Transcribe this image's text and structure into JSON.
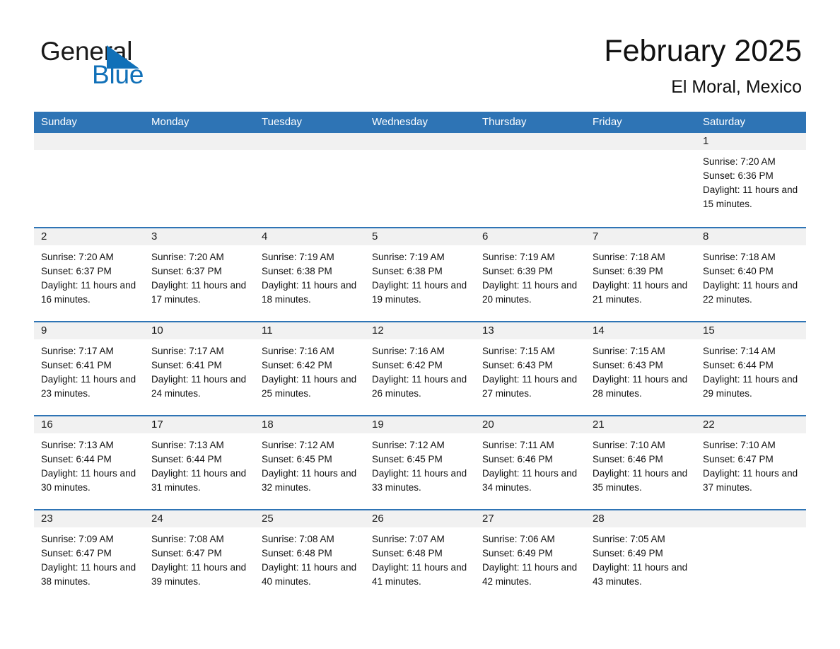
{
  "brand": {
    "name_part1": "General",
    "name_part2": "Blue",
    "triangle_icon": "triangle-icon",
    "accent_color": "#1070b8"
  },
  "header": {
    "title": "February 2025",
    "subtitle": "El Moral, Mexico"
  },
  "theme": {
    "header_blue": "#2e74b5",
    "date_band_gray": "#f1f1f1",
    "text_black": "#111111"
  },
  "calendar": {
    "weekdays": [
      "Sunday",
      "Monday",
      "Tuesday",
      "Wednesday",
      "Thursday",
      "Friday",
      "Saturday"
    ],
    "weeks": [
      {
        "days": [
          {
            "date": "",
            "lines": []
          },
          {
            "date": "",
            "lines": []
          },
          {
            "date": "",
            "lines": []
          },
          {
            "date": "",
            "lines": []
          },
          {
            "date": "",
            "lines": []
          },
          {
            "date": "",
            "lines": []
          },
          {
            "date": "1",
            "lines": [
              "Sunrise: 7:20 AM",
              "Sunset: 6:36 PM",
              "Daylight: 11 hours and 15 minutes."
            ]
          }
        ]
      },
      {
        "days": [
          {
            "date": "2",
            "lines": [
              "Sunrise: 7:20 AM",
              "Sunset: 6:37 PM",
              "Daylight: 11 hours and 16 minutes."
            ]
          },
          {
            "date": "3",
            "lines": [
              "Sunrise: 7:20 AM",
              "Sunset: 6:37 PM",
              "Daylight: 11 hours and 17 minutes."
            ]
          },
          {
            "date": "4",
            "lines": [
              "Sunrise: 7:19 AM",
              "Sunset: 6:38 PM",
              "Daylight: 11 hours and 18 minutes."
            ]
          },
          {
            "date": "5",
            "lines": [
              "Sunrise: 7:19 AM",
              "Sunset: 6:38 PM",
              "Daylight: 11 hours and 19 minutes."
            ]
          },
          {
            "date": "6",
            "lines": [
              "Sunrise: 7:19 AM",
              "Sunset: 6:39 PM",
              "Daylight: 11 hours and 20 minutes."
            ]
          },
          {
            "date": "7",
            "lines": [
              "Sunrise: 7:18 AM",
              "Sunset: 6:39 PM",
              "Daylight: 11 hours and 21 minutes."
            ]
          },
          {
            "date": "8",
            "lines": [
              "Sunrise: 7:18 AM",
              "Sunset: 6:40 PM",
              "Daylight: 11 hours and 22 minutes."
            ]
          }
        ]
      },
      {
        "days": [
          {
            "date": "9",
            "lines": [
              "Sunrise: 7:17 AM",
              "Sunset: 6:41 PM",
              "Daylight: 11 hours and 23 minutes."
            ]
          },
          {
            "date": "10",
            "lines": [
              "Sunrise: 7:17 AM",
              "Sunset: 6:41 PM",
              "Daylight: 11 hours and 24 minutes."
            ]
          },
          {
            "date": "11",
            "lines": [
              "Sunrise: 7:16 AM",
              "Sunset: 6:42 PM",
              "Daylight: 11 hours and 25 minutes."
            ]
          },
          {
            "date": "12",
            "lines": [
              "Sunrise: 7:16 AM",
              "Sunset: 6:42 PM",
              "Daylight: 11 hours and 26 minutes."
            ]
          },
          {
            "date": "13",
            "lines": [
              "Sunrise: 7:15 AM",
              "Sunset: 6:43 PM",
              "Daylight: 11 hours and 27 minutes."
            ]
          },
          {
            "date": "14",
            "lines": [
              "Sunrise: 7:15 AM",
              "Sunset: 6:43 PM",
              "Daylight: 11 hours and 28 minutes."
            ]
          },
          {
            "date": "15",
            "lines": [
              "Sunrise: 7:14 AM",
              "Sunset: 6:44 PM",
              "Daylight: 11 hours and 29 minutes."
            ]
          }
        ]
      },
      {
        "days": [
          {
            "date": "16",
            "lines": [
              "Sunrise: 7:13 AM",
              "Sunset: 6:44 PM",
              "Daylight: 11 hours and 30 minutes."
            ]
          },
          {
            "date": "17",
            "lines": [
              "Sunrise: 7:13 AM",
              "Sunset: 6:44 PM",
              "Daylight: 11 hours and 31 minutes."
            ]
          },
          {
            "date": "18",
            "lines": [
              "Sunrise: 7:12 AM",
              "Sunset: 6:45 PM",
              "Daylight: 11 hours and 32 minutes."
            ]
          },
          {
            "date": "19",
            "lines": [
              "Sunrise: 7:12 AM",
              "Sunset: 6:45 PM",
              "Daylight: 11 hours and 33 minutes."
            ]
          },
          {
            "date": "20",
            "lines": [
              "Sunrise: 7:11 AM",
              "Sunset: 6:46 PM",
              "Daylight: 11 hours and 34 minutes."
            ]
          },
          {
            "date": "21",
            "lines": [
              "Sunrise: 7:10 AM",
              "Sunset: 6:46 PM",
              "Daylight: 11 hours and 35 minutes."
            ]
          },
          {
            "date": "22",
            "lines": [
              "Sunrise: 7:10 AM",
              "Sunset: 6:47 PM",
              "Daylight: 11 hours and 37 minutes."
            ]
          }
        ]
      },
      {
        "days": [
          {
            "date": "23",
            "lines": [
              "Sunrise: 7:09 AM",
              "Sunset: 6:47 PM",
              "Daylight: 11 hours and 38 minutes."
            ]
          },
          {
            "date": "24",
            "lines": [
              "Sunrise: 7:08 AM",
              "Sunset: 6:47 PM",
              "Daylight: 11 hours and 39 minutes."
            ]
          },
          {
            "date": "25",
            "lines": [
              "Sunrise: 7:08 AM",
              "Sunset: 6:48 PM",
              "Daylight: 11 hours and 40 minutes."
            ]
          },
          {
            "date": "26",
            "lines": [
              "Sunrise: 7:07 AM",
              "Sunset: 6:48 PM",
              "Daylight: 11 hours and 41 minutes."
            ]
          },
          {
            "date": "27",
            "lines": [
              "Sunrise: 7:06 AM",
              "Sunset: 6:49 PM",
              "Daylight: 11 hours and 42 minutes."
            ]
          },
          {
            "date": "28",
            "lines": [
              "Sunrise: 7:05 AM",
              "Sunset: 6:49 PM",
              "Daylight: 11 hours and 43 minutes."
            ]
          },
          {
            "date": "",
            "lines": []
          }
        ]
      }
    ]
  }
}
